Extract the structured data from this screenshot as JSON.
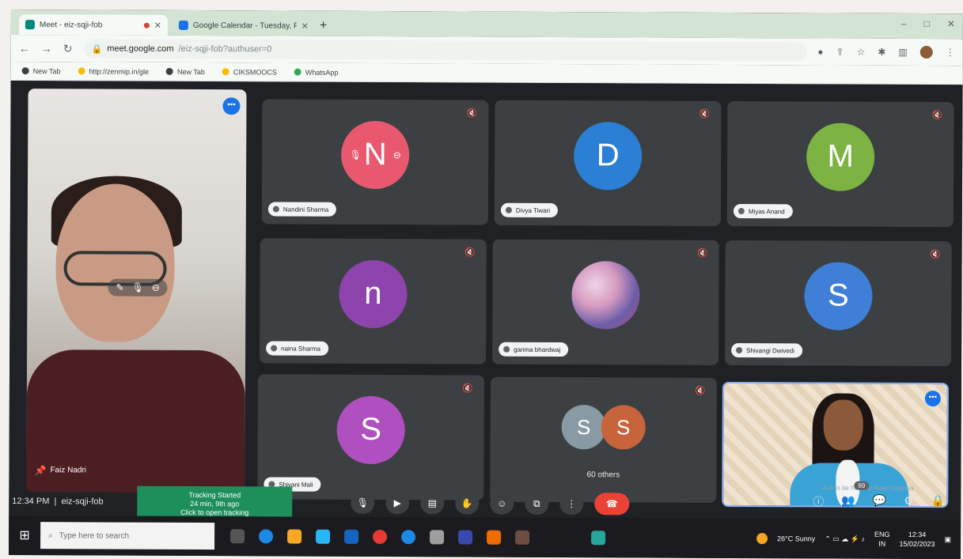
{
  "browser": {
    "tabs": [
      {
        "title": "Meet - eiz-sqji-fob",
        "favicon_color": "#00897b"
      },
      {
        "title": "Google Calendar - Tuesday, Feb…",
        "favicon_color": "#1a73e8"
      }
    ],
    "new_tab": "+",
    "window_controls": [
      "–",
      "□",
      "✕"
    ],
    "url_host": "meet.google.com",
    "url_path": "/eiz-sqji-fob?authuser=0",
    "bookmarks": [
      {
        "label": "New Tab",
        "color": "#3c4043"
      },
      {
        "label": "http://zenmip.in/gle",
        "color": "#fbbc04"
      },
      {
        "label": "New Tab",
        "color": "#3c4043"
      },
      {
        "label": "CIKSMOOCS",
        "color": "#fbbc04"
      },
      {
        "label": "WhatsApp",
        "color": "#34a853"
      }
    ]
  },
  "meet": {
    "self": {
      "name": "Faiz Nadri"
    },
    "participants": [
      {
        "name": "Nandini Sharma",
        "initial": "N",
        "color": "#e8596f",
        "tile_type": "avatar-hover"
      },
      {
        "name": "Divya Tiwari",
        "initial": "D",
        "color": "#2b7fd4",
        "tile_type": "avatar"
      },
      {
        "name": "Miyas Anand",
        "initial": "M",
        "color": "#7cb342",
        "tile_type": "avatar"
      },
      {
        "name": "naina Sharma",
        "initial": "n",
        "color": "#8e44ad",
        "tile_type": "avatar"
      },
      {
        "name": "garima bhardwaj",
        "initial": "",
        "color": "#c07fb0",
        "tile_type": "photo"
      },
      {
        "name": "Shivangi Dwivedi",
        "initial": "S",
        "color": "#3f7fd8",
        "tile_type": "avatar"
      },
      {
        "name": "Shivani Mali",
        "initial": "S",
        "color": "#b04fc0",
        "tile_type": "avatar"
      }
    ],
    "others": {
      "initials": [
        "S",
        "S"
      ],
      "colors": [
        "#8a9aa4",
        "#c8643c"
      ],
      "label": "60 others"
    },
    "time": "12:34 PM",
    "meeting_code": "eiz-sqji-fob",
    "toast": {
      "line1": "Tracking Started",
      "line2": "24 min, 9th ago",
      "line3": "Click to open tracking"
    },
    "people_badge": "69",
    "caption_hint": "Ask to be here for Nadri Sharma"
  },
  "taskbar": {
    "search_placeholder": "Type here to search",
    "weather": "26°C  Sunny",
    "lang": "ENG",
    "region": "IN",
    "time": "12:34",
    "date": "15/02/2023"
  }
}
